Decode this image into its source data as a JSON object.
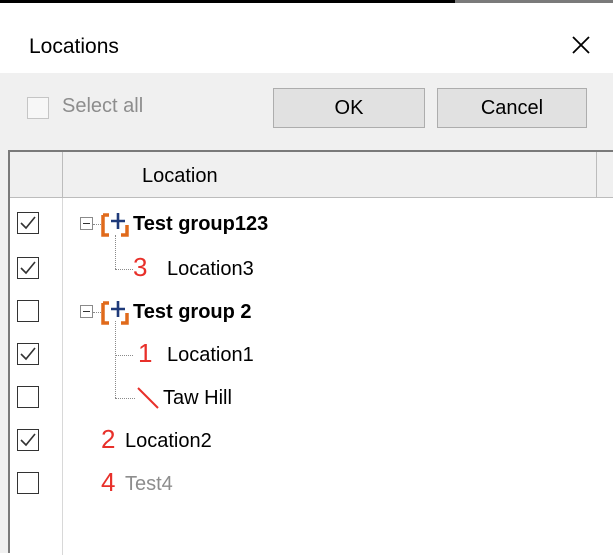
{
  "dialog": {
    "title": "Locations",
    "close_icon": "close-icon"
  },
  "toolbar": {
    "select_all_label": "Select all",
    "ok_label": "OK",
    "cancel_label": "Cancel"
  },
  "grid": {
    "column_header": "Location",
    "rows": [
      {
        "label": "Test group123",
        "type": "group",
        "checked": true,
        "icon": "group-icon"
      },
      {
        "label": "Location3",
        "type": "location",
        "number": "3",
        "checked": true
      },
      {
        "label": "Test group 2",
        "type": "group",
        "checked": false,
        "icon": "group-icon"
      },
      {
        "label": "Location1",
        "type": "location",
        "number": "1",
        "checked": true
      },
      {
        "label": "Taw Hill",
        "type": "location",
        "number": "\\",
        "checked": false
      },
      {
        "label": "Location2",
        "type": "location",
        "number": "2",
        "checked": true
      },
      {
        "label": "Test4",
        "type": "location",
        "number": "4",
        "checked": false,
        "disabled": true
      }
    ]
  },
  "colors": {
    "accent_red": "#e8302a",
    "group_icon_orange": "#e06a1b",
    "group_icon_plus": "#1f3a7a"
  }
}
